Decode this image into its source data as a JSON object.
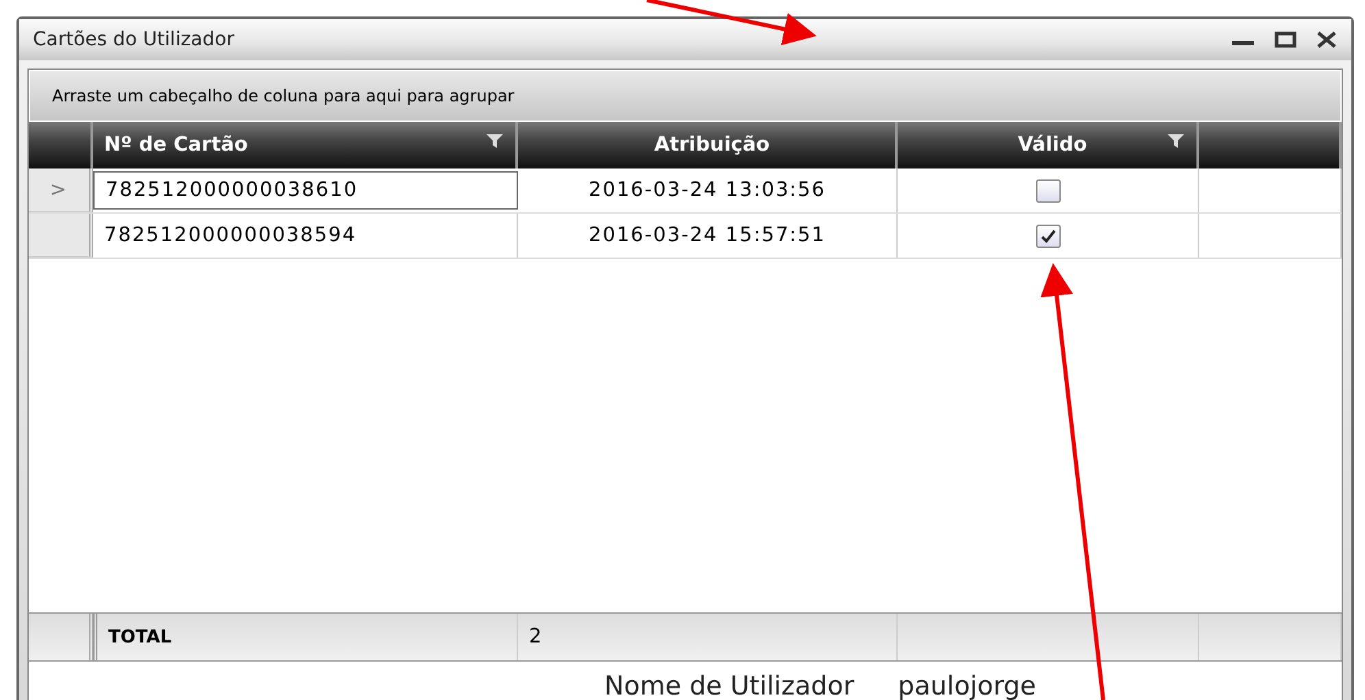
{
  "window": {
    "title": "Cartões do Utilizador"
  },
  "group_panel": {
    "hint": "Arraste um cabeçalho de coluna para aqui para agrupar"
  },
  "table": {
    "columns": [
      {
        "label": "Nº de Cartão",
        "filter": true
      },
      {
        "label": "Atribuição",
        "filter": false
      },
      {
        "label": "Válido",
        "filter": true
      }
    ],
    "rows": [
      {
        "current": true,
        "indicator": ">",
        "card": "782512000000038610",
        "assigned": "2016-03-24 13:03:56",
        "valid": false
      },
      {
        "current": false,
        "indicator": "",
        "card": "782512000000038594",
        "assigned": "2016-03-24 15:57:51",
        "valid": true
      }
    ],
    "footer": {
      "label": "TOTAL",
      "count": "2"
    }
  },
  "user_bar": {
    "label": "Nome de Utilizador",
    "value": "paulojorge"
  }
}
